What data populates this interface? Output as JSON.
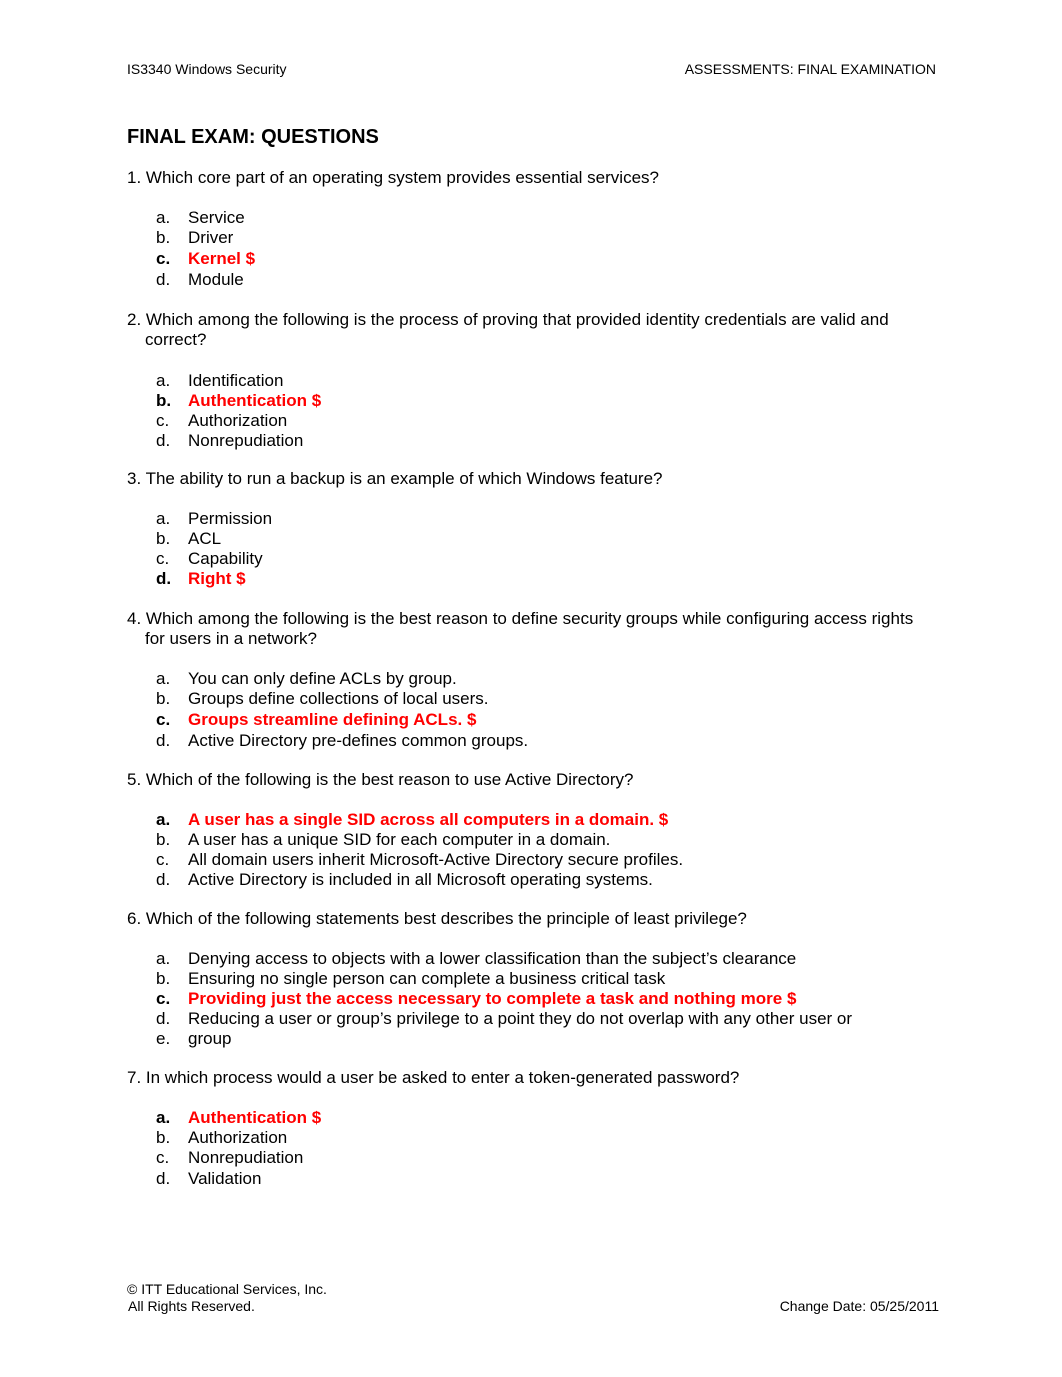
{
  "header": {
    "course": "IS3340 Windows Security",
    "section": "ASSESSMENTS: FINAL EXAMINATION"
  },
  "title": "FINAL EXAM: QUESTIONS",
  "accent_color": "#ff0000",
  "questions": [
    {
      "text": "1. Which core part of an operating system provides essential services?",
      "options": [
        {
          "label": "a.",
          "text": "Service",
          "correct": false
        },
        {
          "label": "b.",
          "text": "Driver",
          "correct": false
        },
        {
          "label": "c.",
          "text": "Kernel $",
          "correct": true
        },
        {
          "label": "d.",
          "text": "Module",
          "correct": false
        }
      ]
    },
    {
      "text": "2. Which among the following is the process of proving that provided identity credentials are valid and correct?",
      "options": [
        {
          "label": "a.",
          "text": "Identification",
          "correct": false
        },
        {
          "label": "b.",
          "text": "Authentication $",
          "correct": true
        },
        {
          "label": "c.",
          "text": "Authorization",
          "correct": false
        },
        {
          "label": "d.",
          "text": "Nonrepudiation",
          "correct": false
        }
      ]
    },
    {
      "text": "3. The ability to run a backup is an example of which Windows feature?",
      "options": [
        {
          "label": "a.",
          "text": "Permission",
          "correct": false
        },
        {
          "label": "b.",
          "text": "ACL",
          "correct": false
        },
        {
          "label": "c.",
          "text": "Capability",
          "correct": false
        },
        {
          "label": "d.",
          "text": "Right $",
          "correct": true
        }
      ]
    },
    {
      "text": "4. Which among the following is the best reason to define security groups while configuring access rights for users in a network?",
      "options": [
        {
          "label": "a.",
          "text": "You can only define ACLs by group.",
          "correct": false
        },
        {
          "label": "b.",
          "text": "Groups define collections of local users.",
          "correct": false
        },
        {
          "label": "c.",
          "text": "Groups streamline defining ACLs. $",
          "correct": true
        },
        {
          "label": "d.",
          "text": "Active Directory pre-defines common groups.",
          "correct": false
        }
      ]
    },
    {
      "text": "5. Which of the following is the best reason to use Active Directory?",
      "options": [
        {
          "label": "a.",
          "text": "A user has a single SID across all computers in a domain. $",
          "correct": true
        },
        {
          "label": "b.",
          "text": "A user has a unique SID for each computer in a domain.",
          "correct": false
        },
        {
          "label": "c.",
          "text": "All domain users inherit Microsoft-Active Directory secure profiles.",
          "correct": false
        },
        {
          "label": "d.",
          "text": "Active Directory is included in all Microsoft operating systems.",
          "correct": false
        }
      ]
    },
    {
      "text": "6. Which of the following statements best describes the principle of least privilege?",
      "options": [
        {
          "label": "a.",
          "text": "Denying access to objects with a lower classification than the subject’s clearance",
          "correct": false
        },
        {
          "label": "b.",
          "text": "Ensuring no single person can complete a business critical task",
          "correct": false
        },
        {
          "label": "c.",
          "text": "Providing just the access necessary to complete a task and nothing more $",
          "correct": true
        },
        {
          "label": "d.",
          "text": "Reducing a user or group’s privilege to a point they do not overlap with any other user or",
          "correct": false
        },
        {
          "label": "e.",
          "text": "group",
          "correct": false
        }
      ]
    },
    {
      "text": "7. In which process would a user be asked to enter a token-generated password?",
      "options": [
        {
          "label": "a.",
          "text": "Authentication $",
          "correct": true
        },
        {
          "label": "b.",
          "text": "Authorization",
          "correct": false
        },
        {
          "label": "c.",
          "text": "Nonrepudiation",
          "correct": false
        },
        {
          "label": "d.",
          "text": "Validation",
          "correct": false
        }
      ]
    }
  ],
  "footer": {
    "copyright": "© ITT Educational Services, Inc.",
    "rights": "All Rights Reserved.",
    "change_date": "Change Date: 05/25/2011"
  }
}
